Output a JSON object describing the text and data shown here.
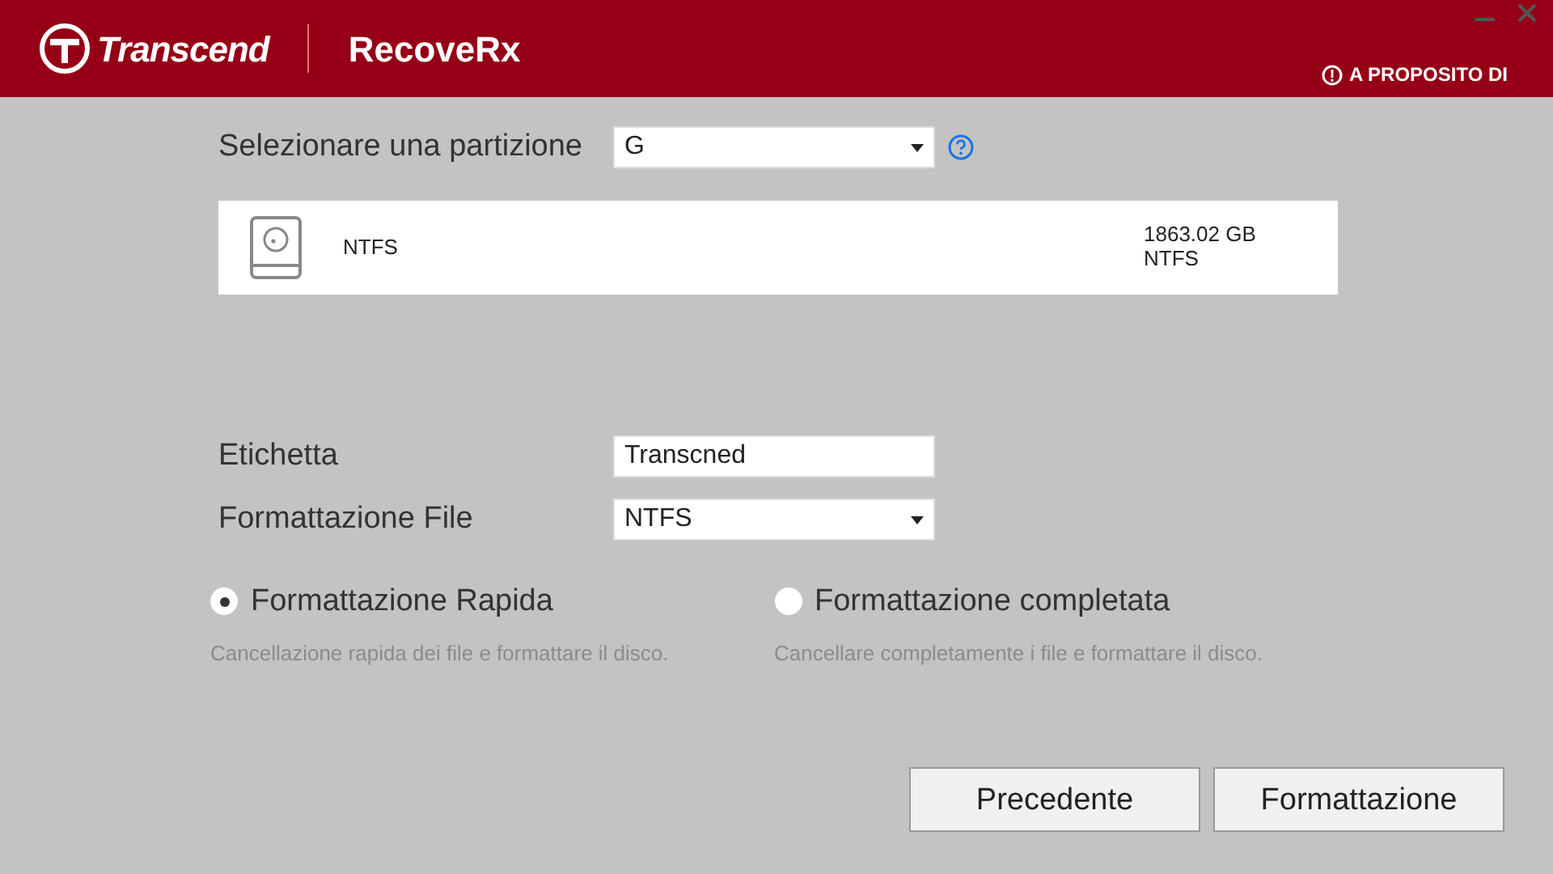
{
  "header": {
    "brand": "Transcend",
    "app": "RecoveRx",
    "about": "A PROPOSITO DI"
  },
  "partition": {
    "label": "Selezionare una partizione",
    "value": "G"
  },
  "drive": {
    "name": "NTFS",
    "size": "1863.02 GB",
    "filesystem": "NTFS"
  },
  "fields": [
    {
      "kind": "text",
      "label": "Etichetta",
      "value": "Transcned"
    },
    {
      "kind": "select",
      "label": "Formattazione File",
      "value": "NTFS"
    }
  ],
  "options": [
    {
      "label": "Formattazione Rapida",
      "description": "Cancellazione rapida dei file e formattare il disco.",
      "selected": true
    },
    {
      "label": "Formattazione completata",
      "description": "Cancellare completamente i file e formattare il disco.",
      "selected": false
    }
  ],
  "buttons": [
    "Precedente",
    "Formattazione"
  ]
}
